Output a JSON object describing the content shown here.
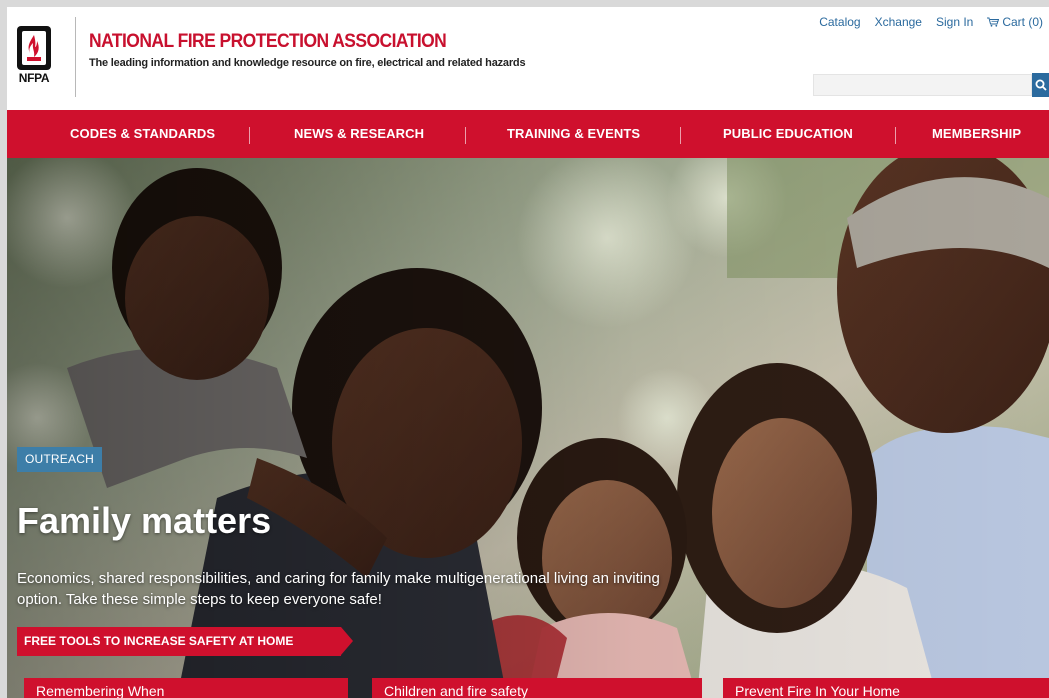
{
  "header": {
    "logo_text": "NFPA",
    "org_name": "NATIONAL FIRE PROTECTION ASSOCIATION",
    "tagline": "The leading information and knowledge resource on fire, electrical and related hazards"
  },
  "utility_links": {
    "catalog": "Catalog",
    "xchange": "Xchange",
    "sign_in": "Sign In",
    "cart": "Cart (0)"
  },
  "search": {
    "value": "",
    "placeholder": ""
  },
  "nav": {
    "items": [
      {
        "label": "CODES & STANDARDS"
      },
      {
        "label": "NEWS & RESEARCH"
      },
      {
        "label": "TRAINING & EVENTS"
      },
      {
        "label": "PUBLIC EDUCATION"
      },
      {
        "label": "MEMBERSHIP"
      }
    ]
  },
  "hero": {
    "badge": "OUTREACH",
    "title": "Family matters",
    "description": "Economics, shared responsibilities, and caring for family make multigenerational living an inviting option. Take these simple steps to keep everyone safe!",
    "cta_label": "FREE TOOLS TO INCREASE SAFETY AT HOME"
  },
  "feature_tabs": [
    {
      "label": "Remembering When"
    },
    {
      "label": "Children and fire safety"
    },
    {
      "label": "Prevent Fire In Your Home"
    }
  ],
  "colors": {
    "brand_red": "#cf102d",
    "link_blue": "#2b6a9e",
    "badge_blue": "#3d7ea8"
  }
}
